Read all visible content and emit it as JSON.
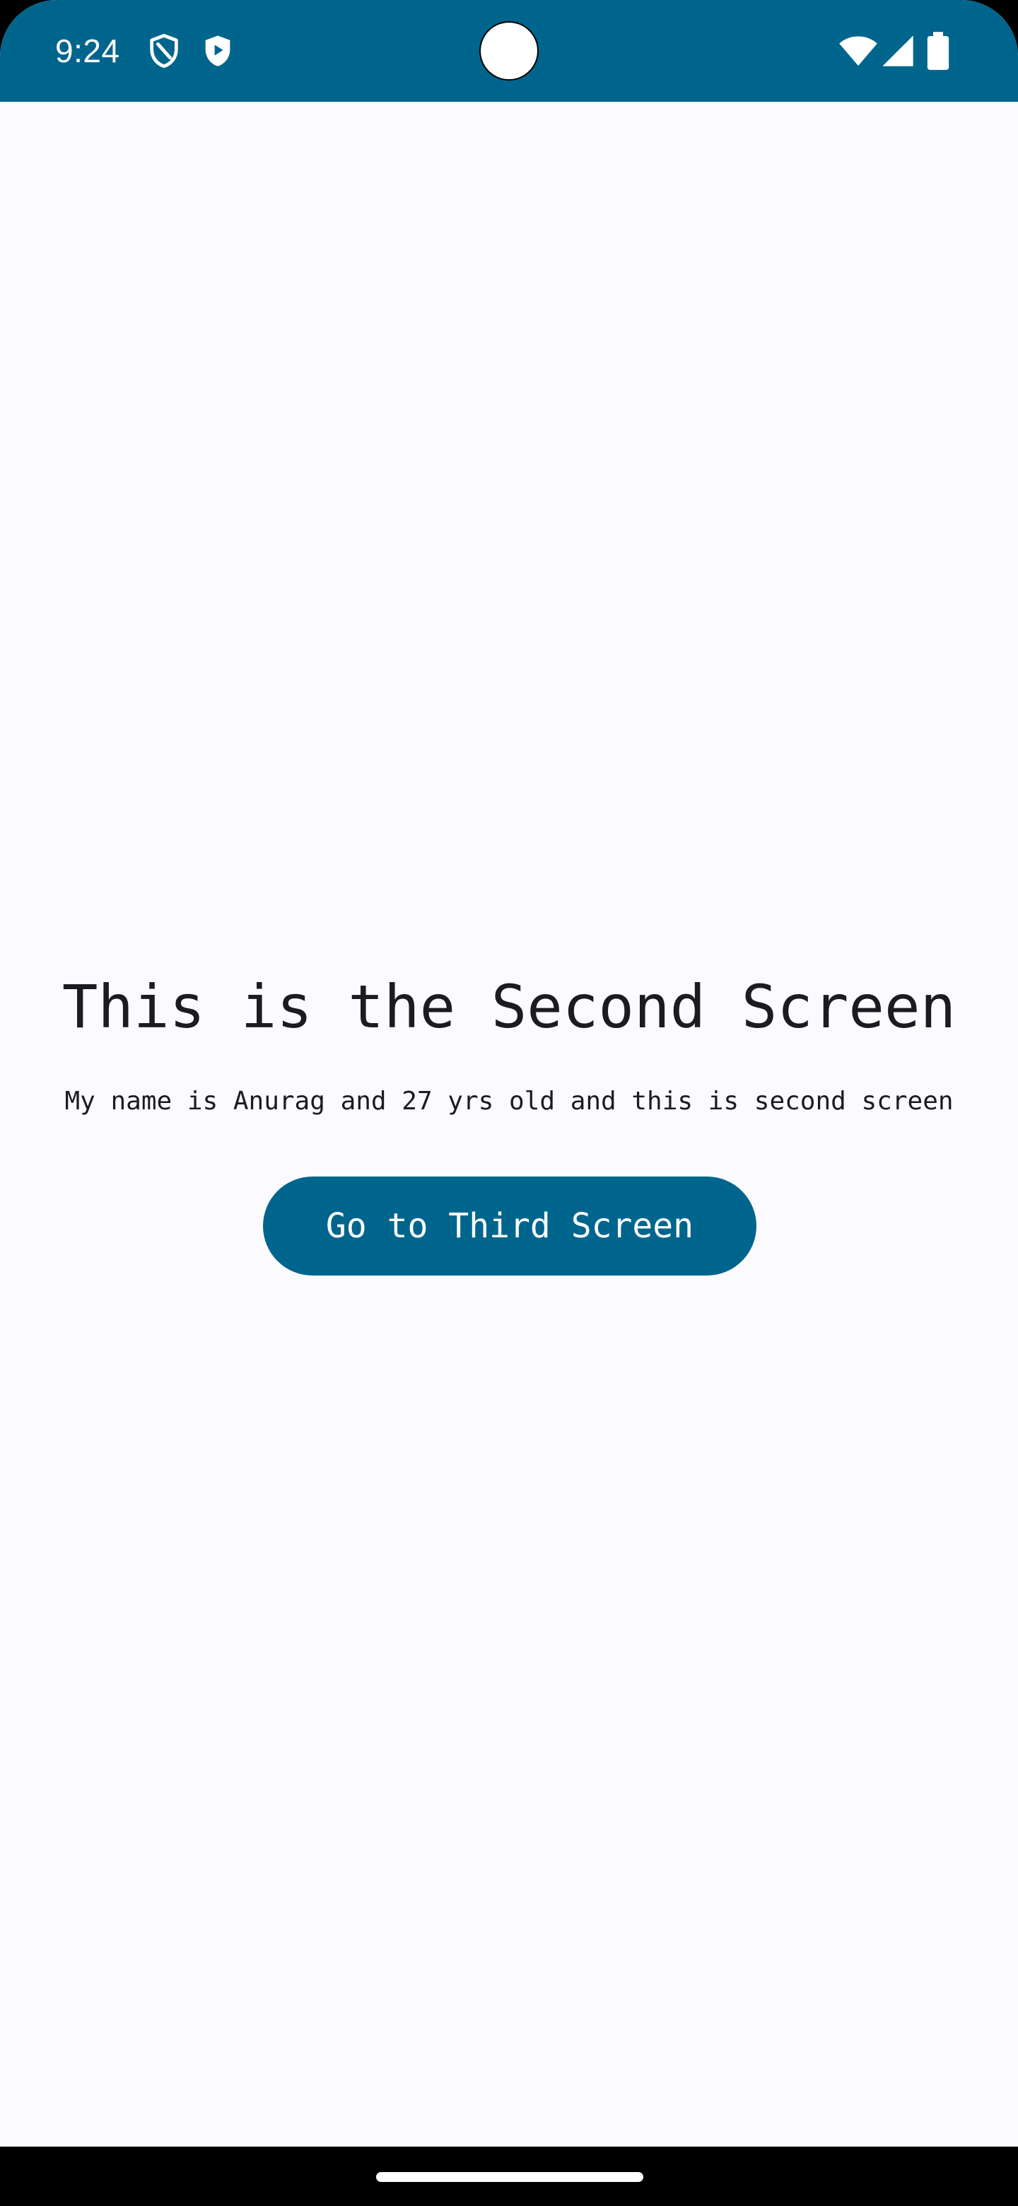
{
  "status_bar": {
    "time": "9:24",
    "icons": [
      "shield-icon",
      "play-protect-icon",
      "wifi-icon",
      "signal-icon",
      "battery-icon"
    ],
    "background_color": "#00658d"
  },
  "main": {
    "title": "This is the Second Screen",
    "subtitle": "My name is Anurag and 27 yrs old and this is second screen",
    "button_label": "Go to Third Screen",
    "button_color": "#00658d"
  },
  "navigation_bar": {
    "gesture_handle": "home-gesture-handle"
  }
}
